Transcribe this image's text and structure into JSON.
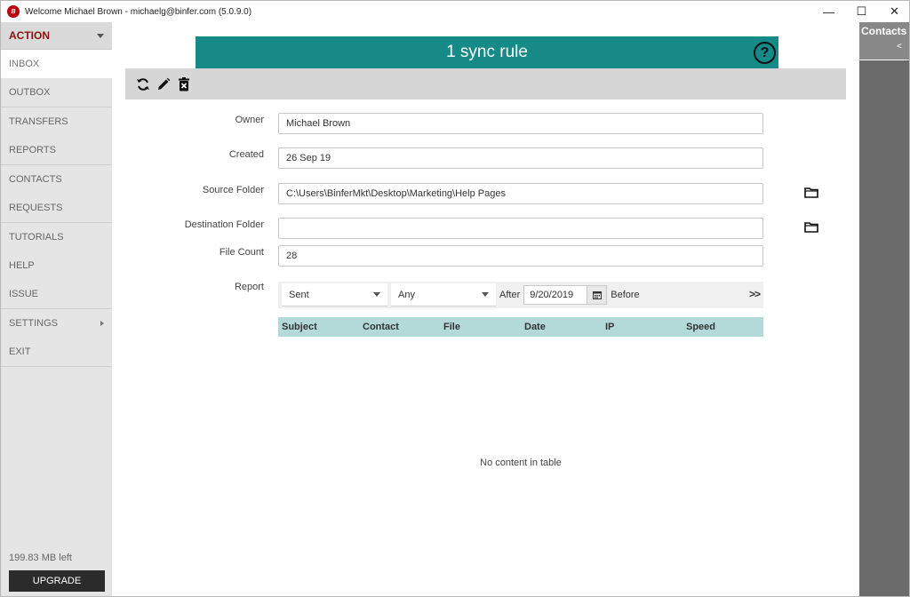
{
  "window": {
    "app_icon_text": "B",
    "title": "Welcome  Michael Brown - michaelg@binfer.com (5.0.9.0)",
    "minimize": "—",
    "maximize": "☐",
    "close": "✕"
  },
  "sidebar": {
    "action_label": "ACTION",
    "items": [
      {
        "label": "INBOX"
      },
      {
        "label": "OUTBOX"
      },
      {
        "label": "TRANSFERS"
      },
      {
        "label": "REPORTS"
      },
      {
        "label": "CONTACTS"
      },
      {
        "label": "REQUESTS"
      },
      {
        "label": "TUTORIALS"
      },
      {
        "label": "HELP"
      },
      {
        "label": "ISSUE"
      },
      {
        "label": "SETTINGS"
      },
      {
        "label": "EXIT"
      }
    ],
    "storage_left": "199.83 MB left",
    "upgrade_label": "UPGRADE"
  },
  "contacts_panel": {
    "label": "Contacts",
    "toggle": "<"
  },
  "main": {
    "banner_title": "1 sync rule",
    "help_symbol": "?",
    "toolbar": {
      "icons": [
        "sync-icon",
        "edit-icon",
        "delete-icon"
      ]
    },
    "fields": {
      "owner_label": "Owner",
      "owner_value": "Michael Brown",
      "created_label": "Created",
      "created_value": "26 Sep 19",
      "source_label": "Source Folder",
      "source_value": "C:\\Users\\BinferMkt\\Desktop\\Marketing\\Help Pages",
      "destination_label": "Destination Folder",
      "destination_value": "",
      "filecount_label": "File Count",
      "filecount_value": "28",
      "report_label": "Report"
    },
    "report": {
      "type_value": "Sent",
      "contact_value": "Any",
      "after_label": "After",
      "after_date": "9/20/2019",
      "before_label": "Before",
      "more_label": ">>"
    },
    "table": {
      "columns": [
        "Subject",
        "Contact",
        "File",
        "Date",
        "IP",
        "Speed"
      ],
      "empty_message": "No content in table"
    }
  },
  "colors": {
    "accent_teal": "#158a87",
    "table_header": "#b3dad9",
    "action_red": "#8b0f14",
    "sidebar_bg": "#e5e5e5",
    "contacts_bg": "#6b6b6b"
  }
}
